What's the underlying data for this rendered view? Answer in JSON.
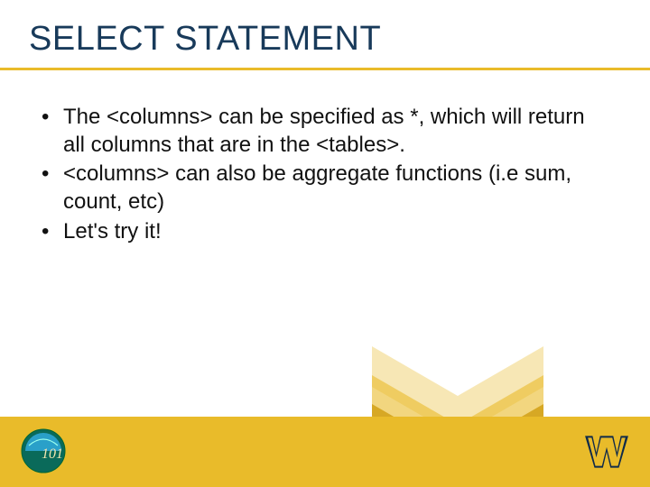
{
  "title": "SELECT STATEMENT",
  "bullets": [
    "The <columns> can be specified as *, which will return all columns that are in the <tables>.",
    "<columns> can also be aggregate functions (i.e sum, count, etc)",
    "Let's try it!"
  ],
  "colors": {
    "title": "#183a5a",
    "accent": "#e9bb2a",
    "wv_navy": "#0f2a4a",
    "wv_gold": "#e9bb2a"
  },
  "logos": {
    "left": "cs101-globe-logo",
    "right": "wvu-flying-wv"
  }
}
